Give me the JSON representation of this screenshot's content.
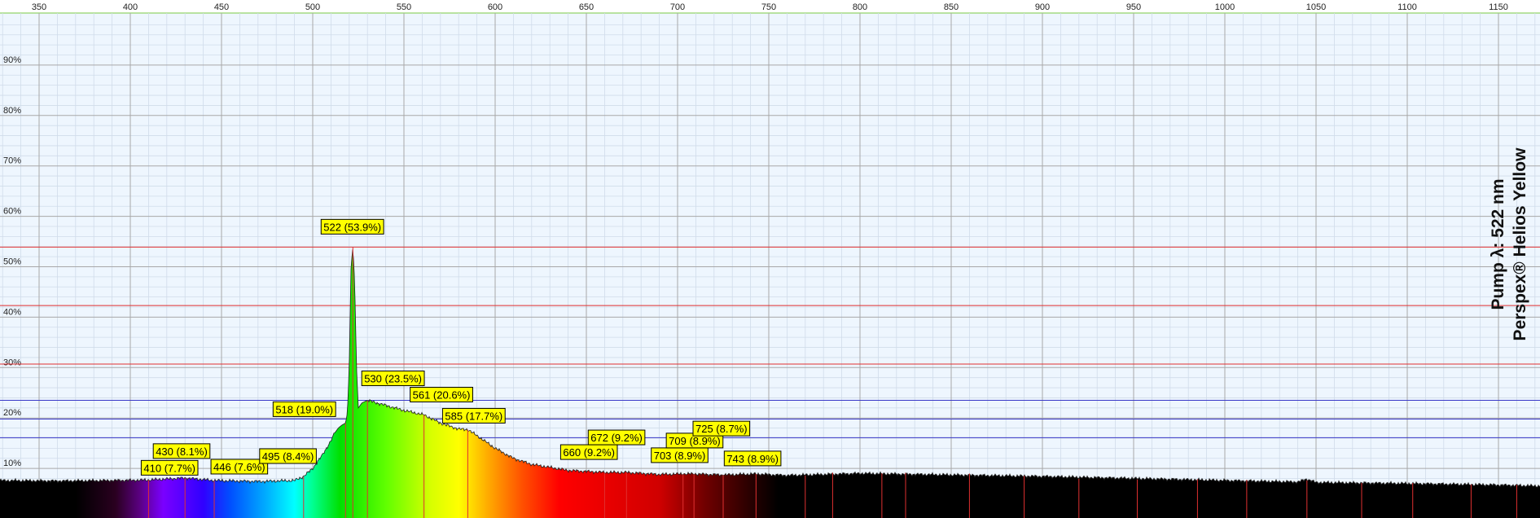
{
  "chart_data": {
    "type": "area",
    "title_lines": [
      "Pump λ: 522 nm",
      "Perspex® Helios Yellow"
    ],
    "xlim": [
      330,
      1195
    ],
    "ylim": [
      0,
      100
    ],
    "x_ticks": [
      350,
      400,
      450,
      500,
      550,
      600,
      650,
      700,
      750,
      800,
      850,
      900,
      950,
      1000,
      1050,
      1100,
      1150
    ],
    "y_ticks": [
      10,
      20,
      30,
      40,
      50,
      60,
      70,
      80,
      90
    ],
    "y_tick_labels": [
      "10%",
      "20%",
      "30%",
      "40%",
      "50%",
      "60%",
      "70%",
      "80%",
      "90%"
    ],
    "grid": true,
    "baseline_level": 7.5,
    "series": [
      {
        "x": [
          330,
          360,
          390,
          410,
          430,
          446,
          470,
          490,
          495,
          500,
          505,
          510,
          512,
          514,
          516,
          518,
          519,
          520,
          521,
          522,
          523,
          524,
          525,
          527,
          530,
          540,
          550,
          561,
          570,
          580,
          585,
          590,
          600,
          610,
          620,
          640,
          660,
          672,
          690,
          703,
          709,
          725,
          743,
          760,
          800,
          850,
          900,
          950,
          1000,
          1040,
          1045,
          1050,
          1100,
          1150,
          1195
        ],
        "y": [
          7.6,
          7.5,
          7.6,
          7.7,
          8.1,
          7.6,
          7.4,
          7.6,
          8.4,
          10.0,
          12.5,
          15.5,
          17.0,
          18.0,
          18.6,
          19.0,
          21.0,
          30.0,
          50.0,
          53.9,
          47.0,
          30.0,
          22.0,
          23.0,
          23.5,
          22.5,
          21.5,
          20.6,
          19.0,
          17.8,
          17.7,
          16.5,
          14.0,
          12.0,
          10.8,
          9.6,
          9.2,
          9.2,
          8.8,
          8.9,
          8.9,
          8.7,
          8.9,
          8.6,
          9.0,
          8.7,
          8.4,
          8.0,
          7.6,
          7.3,
          7.9,
          7.2,
          7.0,
          6.7,
          6.3
        ]
      }
    ],
    "peak_labels": [
      {
        "x": 410,
        "y": 7.7,
        "text": "410 (7.7%)"
      },
      {
        "x": 430,
        "y": 8.1,
        "text": "430 (8.1%)"
      },
      {
        "x": 446,
        "y": 7.6,
        "text": "446 (7.6%)"
      },
      {
        "x": 495,
        "y": 8.4,
        "text": "495 (8.4%)"
      },
      {
        "x": 518,
        "y": 19.0,
        "text": "518 (19.0%)"
      },
      {
        "x": 522,
        "y": 53.9,
        "text": "522 (53.9%)"
      },
      {
        "x": 530,
        "y": 23.5,
        "text": "530 (23.5%)"
      },
      {
        "x": 561,
        "y": 20.6,
        "text": "561 (20.6%)"
      },
      {
        "x": 585,
        "y": 17.7,
        "text": "585 (17.7%)"
      },
      {
        "x": 660,
        "y": 9.2,
        "text": "660 (9.2%)"
      },
      {
        "x": 672,
        "y": 9.2,
        "text": "672 (9.2%)"
      },
      {
        "x": 703,
        "y": 8.9,
        "text": "703 (8.9%)"
      },
      {
        "x": 709,
        "y": 8.9,
        "text": "709 (8.9%)"
      },
      {
        "x": 725,
        "y": 8.7,
        "text": "725 (8.7%)"
      },
      {
        "x": 743,
        "y": 8.9,
        "text": "743 (8.9%)"
      }
    ],
    "red_reference_levels": [
      53.9,
      42.3,
      30.7
    ],
    "blue_reference_levels": [
      23.5,
      19.8,
      16.1
    ],
    "colors": {
      "background": "#eef6fe",
      "grid_major": "#a8a8a8",
      "grid_minor": "#d0dcea",
      "red_line": "#e03030",
      "blue_line": "#3838c8",
      "fill_dark": "#000000",
      "label_bg": "#ffff00",
      "top_line": "#7ac943"
    }
  }
}
